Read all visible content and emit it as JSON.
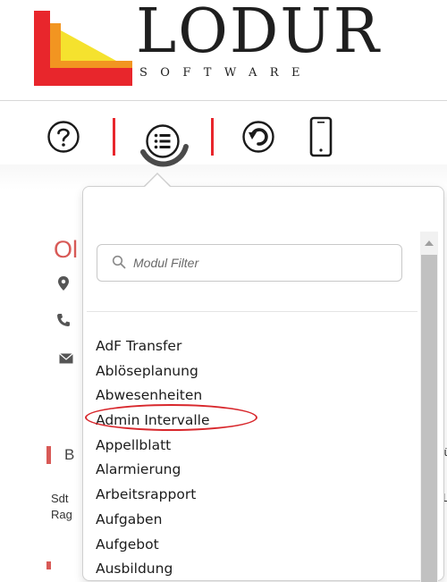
{
  "brand": {
    "name": "LODUR",
    "tagline": "SOFTWARE",
    "colors": {
      "logo_red": "#e8262c",
      "logo_orange": "#f29521",
      "logo_yellow": "#f5e22e",
      "accent": "#d85a57"
    }
  },
  "toolbar": {
    "items": [
      {
        "icon": "help-icon"
      },
      {
        "icon": "list-menu-icon"
      },
      {
        "icon": "history-back-icon"
      },
      {
        "icon": "mobile-phone-icon"
      }
    ]
  },
  "background": {
    "title": "Ol",
    "section_title": "B",
    "small_line_1": "Sdt",
    "small_line_2": "Rag",
    "edge_text_1": "fü",
    "edge_text_2": "L"
  },
  "module_menu": {
    "filter": {
      "placeholder": "Modul Filter",
      "value": ""
    },
    "items": [
      "AdF Transfer",
      "Ablöseplanung",
      "Abwesenheiten",
      "Admin Intervalle",
      "Appellblatt",
      "Alarmierung",
      "Arbeitsrapport",
      "Aufgaben",
      "Aufgebot",
      "Ausbildung"
    ],
    "highlighted_item": "Admin Intervalle"
  }
}
